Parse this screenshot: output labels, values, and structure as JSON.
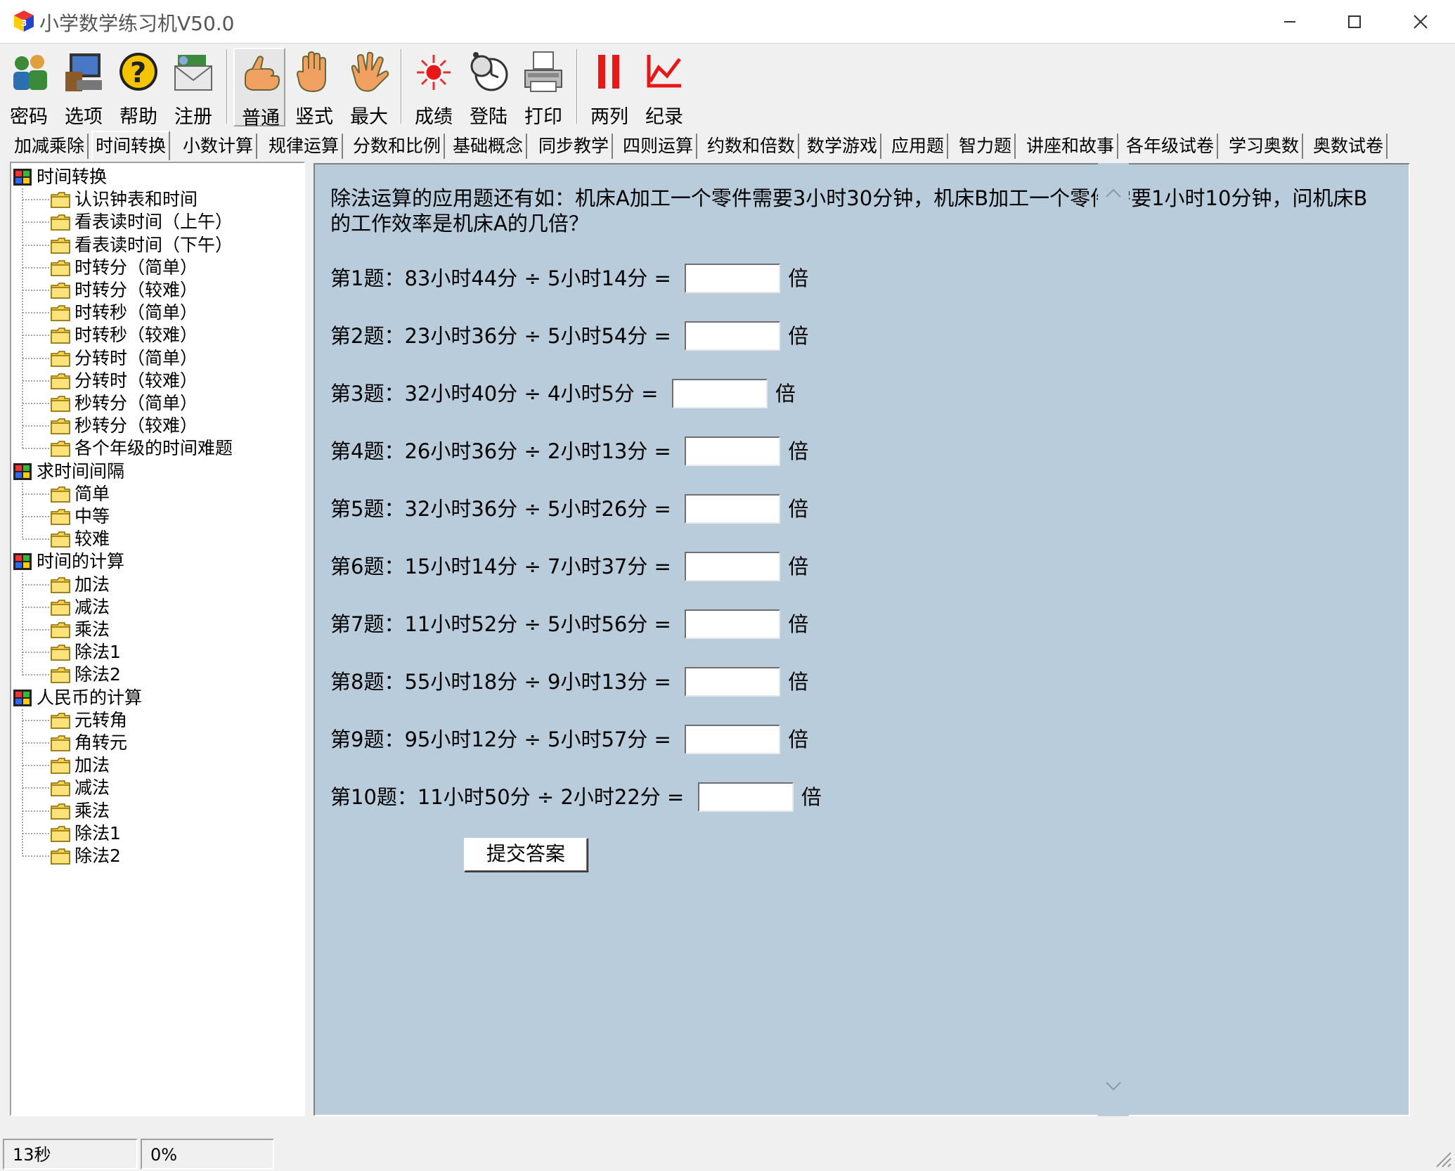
{
  "window": {
    "title": "小学数学练习机V50.0"
  },
  "toolbar": {
    "buttons": [
      {
        "label": "密码",
        "icon": "users-icon"
      },
      {
        "label": "选项",
        "icon": "computer-icon"
      },
      {
        "label": "帮助",
        "icon": "help-icon"
      },
      {
        "label": "注册",
        "icon": "mail-icon"
      },
      {
        "label": "普通",
        "icon": "hand-point-icon"
      },
      {
        "label": "竖式",
        "icon": "hand-open-icon"
      },
      {
        "label": "最大",
        "icon": "hand-wave-icon"
      },
      {
        "label": "成绩",
        "icon": "star-burst-icon"
      },
      {
        "label": "登陆",
        "icon": "clock-icon"
      },
      {
        "label": "打印",
        "icon": "printer-icon"
      },
      {
        "label": "两列",
        "icon": "two-columns-icon"
      },
      {
        "label": "纪录",
        "icon": "line-chart-icon"
      }
    ]
  },
  "tabs": [
    "加减乘除",
    "时间转换",
    "小数计算",
    "规律运算",
    "分数和比例",
    "基础概念",
    "同步教学",
    "四则运算",
    "约数和倍数",
    "数学游戏",
    "应用题",
    "智力题",
    "讲座和故事",
    "各年级试卷",
    "学习奥数",
    "奥数试卷"
  ],
  "tree": {
    "groups": [
      {
        "label": "时间转换",
        "items": [
          "认识钟表和时间",
          "看表读时间（上午）",
          "看表读时间（下午）",
          "时转分（简单）",
          "时转分（较难）",
          "时转秒（简单）",
          "时转秒（较难）",
          "分转时（简单）",
          "分转时（较难）",
          "秒转分（简单）",
          "秒转分（较难）",
          "各个年级的时间难题"
        ]
      },
      {
        "label": "求时间间隔",
        "items": [
          "简单",
          "中等",
          "较难"
        ]
      },
      {
        "label": "时间的计算",
        "items": [
          "加法",
          "减法",
          "乘法",
          "除法1",
          "除法2"
        ]
      },
      {
        "label": "人民币的计算",
        "items": [
          "元转角",
          "角转元",
          "加法",
          "减法",
          "乘法",
          "除法1",
          "除法2"
        ]
      }
    ]
  },
  "main": {
    "problem": "除法运算的应用题还有如：机床A加工一个零件需要3小时30分钟，机床B加工一个零件需要1小时10分钟，问机床B的工作效率是机床A的几倍？",
    "questions": [
      {
        "text": "第1题：83小时44分 ÷ 5小时14分 =",
        "unit": "倍",
        "answer": ""
      },
      {
        "text": "第2题：23小时36分 ÷ 5小时54分 =",
        "unit": "倍",
        "answer": ""
      },
      {
        "text": "第3题：32小时40分 ÷ 4小时5分 =",
        "unit": "倍",
        "answer": ""
      },
      {
        "text": "第4题：26小时36分 ÷ 2小时13分 =",
        "unit": "倍",
        "answer": ""
      },
      {
        "text": "第5题：32小时36分 ÷ 5小时26分 =",
        "unit": "倍",
        "answer": ""
      },
      {
        "text": "第6题：15小时14分 ÷ 7小时37分 =",
        "unit": "倍",
        "answer": ""
      },
      {
        "text": "第7题：11小时52分 ÷ 5小时56分 =",
        "unit": "倍",
        "answer": ""
      },
      {
        "text": "第8题：55小时18分 ÷ 9小时13分 =",
        "unit": "倍",
        "answer": ""
      },
      {
        "text": "第9题：95小时12分 ÷ 5小时57分 =",
        "unit": "倍",
        "answer": ""
      },
      {
        "text": "第10题：11小时50分 ÷ 2小时22分 =",
        "unit": "倍",
        "answer": ""
      }
    ],
    "submit_label": "提交答案"
  },
  "status": {
    "time": "13秒",
    "progress": "0%"
  },
  "colors": {
    "content_bg": "#b8ccdc",
    "window_bg": "#f0f0f0"
  }
}
